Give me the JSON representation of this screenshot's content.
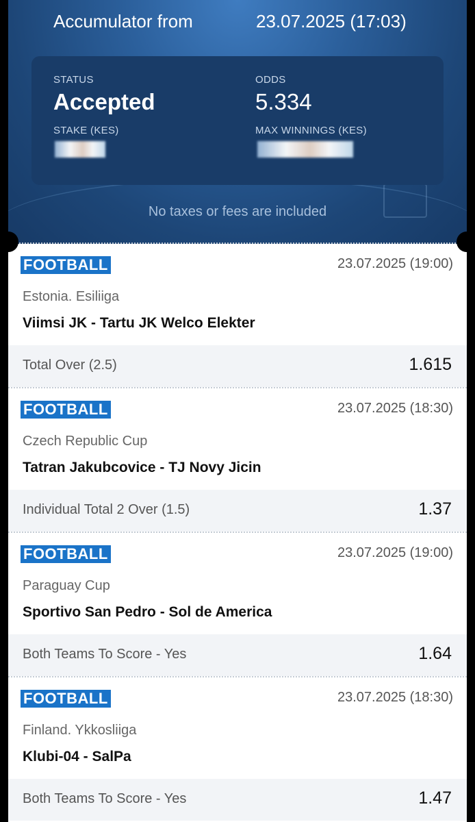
{
  "header": {
    "title": "Accumulator from",
    "date": "23.07.2025 (17:03)",
    "status_label": "STATUS",
    "status_value": "Accepted",
    "odds_label": "ODDS",
    "odds_value": "5.334",
    "stake_label": "STAKE (KES)",
    "max_winnings_label": "MAX WINNINGS (KES)",
    "notice": "No taxes or fees are included"
  },
  "bets": [
    {
      "sport": "FOOTBALL",
      "date": "23.07.2025 (19:00)",
      "league": "Estonia. Esiliiga",
      "match": "Viimsi JK - Tartu JK Welco Elekter",
      "market": "Total Over (2.5)",
      "odd": "1.615"
    },
    {
      "sport": "FOOTBALL",
      "date": "23.07.2025 (18:30)",
      "league": "Czech Republic Cup",
      "match": "Tatran Jakubcovice - TJ Novy Jicin",
      "market": "Individual Total 2 Over (1.5)",
      "odd": "1.37"
    },
    {
      "sport": "FOOTBALL",
      "date": "23.07.2025 (19:00)",
      "league": "Paraguay Cup",
      "match": "Sportivo San Pedro - Sol de America",
      "market": "Both Teams To Score - Yes",
      "odd": "1.64"
    },
    {
      "sport": "FOOTBALL",
      "date": "23.07.2025 (18:30)",
      "league": "Finland. Ykkosliiga",
      "match": "Klubi-04 - SalPa",
      "market": "Both Teams To Score - Yes",
      "odd": "1.47"
    }
  ],
  "colors": {
    "sport_badge": "#1a73c8",
    "card_bg": "#193c68",
    "header_bg": "#2b5f9b"
  }
}
